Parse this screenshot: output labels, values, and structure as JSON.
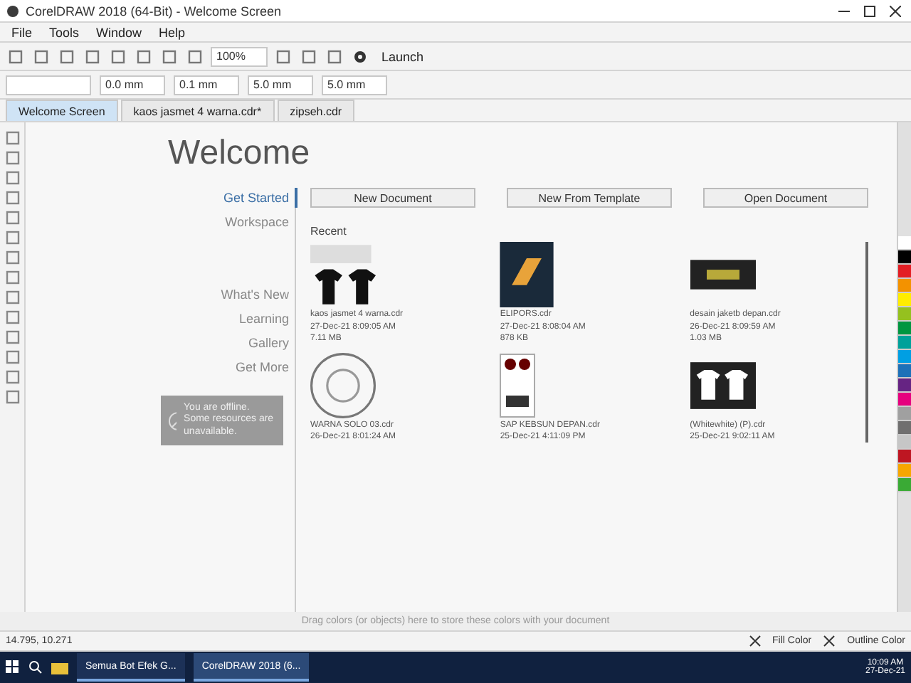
{
  "window": {
    "title": "CorelDRAW 2018 (64-Bit) - Welcome Screen"
  },
  "menu": [
    "File",
    "Tools",
    "Window",
    "Help"
  ],
  "toolbar": {
    "zoom": "100%",
    "launch": "Launch"
  },
  "property_bar": {
    "width": "0.0 mm",
    "nudge": "0.1 mm",
    "dup_x": "5.0 mm",
    "dup_y": "5.0 mm"
  },
  "doc_tabs": [
    {
      "label": "Welcome Screen",
      "selected": true
    },
    {
      "label": "kaos jasmet 4 warna.cdr*",
      "selected": false
    },
    {
      "label": "zipseh.cdr",
      "selected": false
    }
  ],
  "welcome": {
    "heading": "Welcome",
    "nav": [
      {
        "label": "Get Started",
        "selected": true
      },
      {
        "label": "Workspace",
        "selected": false
      },
      {
        "label": "What's New",
        "selected": false
      },
      {
        "label": "Learning",
        "selected": false
      },
      {
        "label": "Gallery",
        "selected": false
      },
      {
        "label": "Get More",
        "selected": false
      }
    ],
    "offline": "You are offline. Some resources are unavailable.",
    "actions": [
      "New Document",
      "New From Template",
      "Open Document"
    ],
    "recent_title": "Recent",
    "recent": [
      {
        "kind": "tshirts",
        "name": "kaos jasmet 4 warna.cdr",
        "date": "27-Dec-21 8:09:05 AM",
        "size": "7.11 MB"
      },
      {
        "kind": "logo",
        "name": "ELIPORS.cdr",
        "date": "27-Dec-21 8:08:04 AM",
        "size": "878 KB"
      },
      {
        "kind": "banner",
        "name": "desain jaketb depan.cdr",
        "date": "26-Dec-21 8:09:59 AM",
        "size": "1.03 MB"
      },
      {
        "kind": "stamp",
        "name": "WARNA SOLO 03.cdr",
        "date": "26-Dec-21 8:01:24 AM"
      },
      {
        "kind": "sticker",
        "name": "SAP KEBSUN DEPAN.cdr",
        "date": "25-Dec-21 4:11:09 PM"
      },
      {
        "kind": "shirts-white",
        "name": "(Whitewhite) (P).cdr",
        "date": "25-Dec-21 9:02:11 AM"
      }
    ]
  },
  "palette": [
    {
      "color": "#ffffff"
    },
    {
      "color": "#000000"
    },
    {
      "color": "#e31e24"
    },
    {
      "color": "#f39200"
    },
    {
      "color": "#ffed00"
    },
    {
      "color": "#95c11f"
    },
    {
      "color": "#009640"
    },
    {
      "color": "#00a19a"
    },
    {
      "color": "#009fe3"
    },
    {
      "color": "#1d71b8"
    },
    {
      "color": "#662483"
    },
    {
      "color": "#e6007e"
    },
    {
      "color": "#a0a0a0"
    },
    {
      "color": "#706f6f"
    },
    {
      "color": "#c6c6c6"
    },
    {
      "color": "#be1622"
    },
    {
      "color": "#f7a600"
    },
    {
      "color": "#3aaa35"
    }
  ],
  "status": {
    "hint": "Drag colors (or objects) here to store these colors with your document",
    "coords": "14.795, 10.271",
    "fill": "Fill Color",
    "outline": "Outline Color"
  },
  "taskbar": {
    "apps": [
      {
        "label": "Semua Bot Efek G...",
        "selected": false
      },
      {
        "label": "CorelDRAW 2018 (6...",
        "selected": true
      }
    ],
    "time": "10:09 AM",
    "date": "27-Dec-21"
  }
}
